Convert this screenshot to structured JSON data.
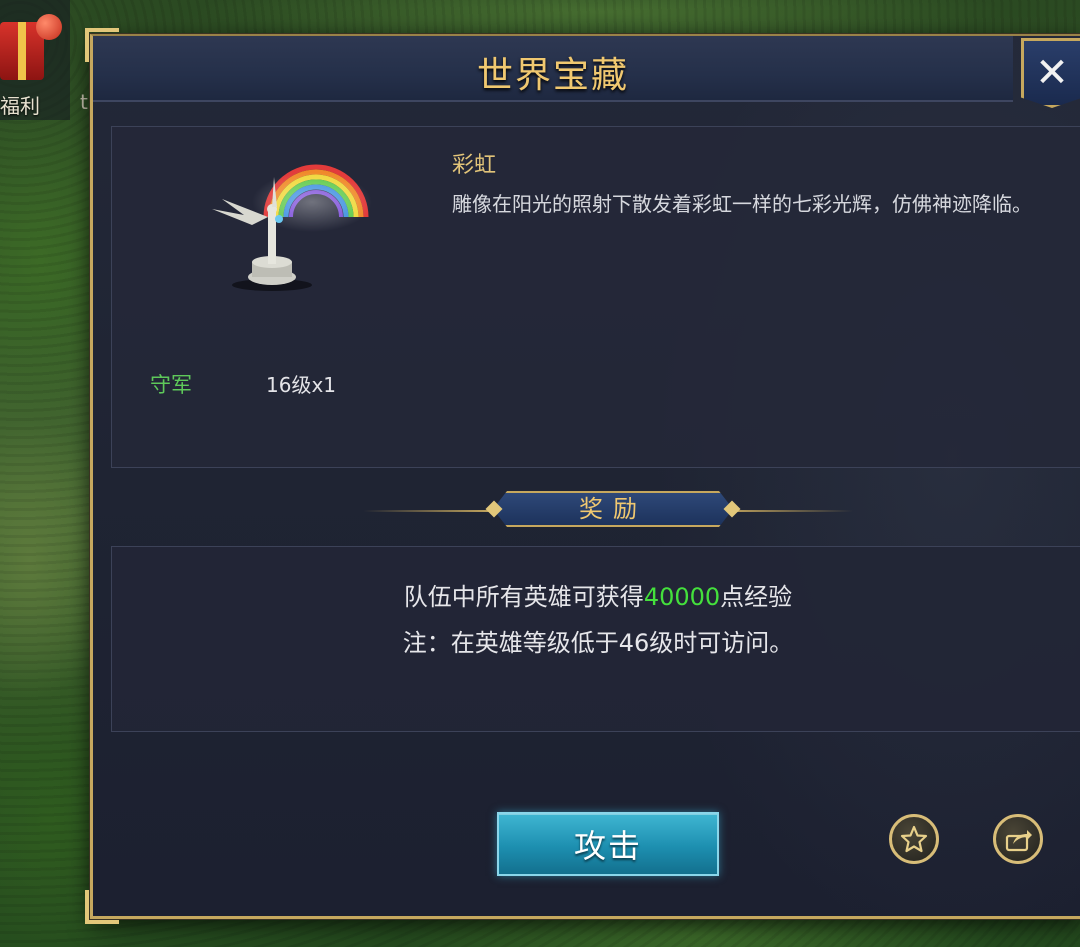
{
  "hud": {
    "welfare_label": "福利",
    "second_label": "t"
  },
  "dialog": {
    "title": "世界宝藏",
    "close_icon": "close-icon"
  },
  "treasure": {
    "name": "彩虹",
    "description": "雕像在阳光的照射下散发着彩虹一样的七彩光辉，仿佛神迹降临。",
    "guard_label": "守军",
    "guard_value": "16级x1"
  },
  "reward": {
    "header": "奖励",
    "line1_prefix": "队伍中所有英雄可获得",
    "line1_amount": "40000",
    "line1_suffix": "点经验",
    "line2": "注：在英雄等级低于46级时可访问。"
  },
  "actions": {
    "attack_label": "攻击",
    "favorite_icon": "star-icon",
    "share_icon": "share-icon"
  },
  "colors": {
    "gold": "#f0c870",
    "green": "#44e03c",
    "button_blue": "#1d8fb0"
  }
}
